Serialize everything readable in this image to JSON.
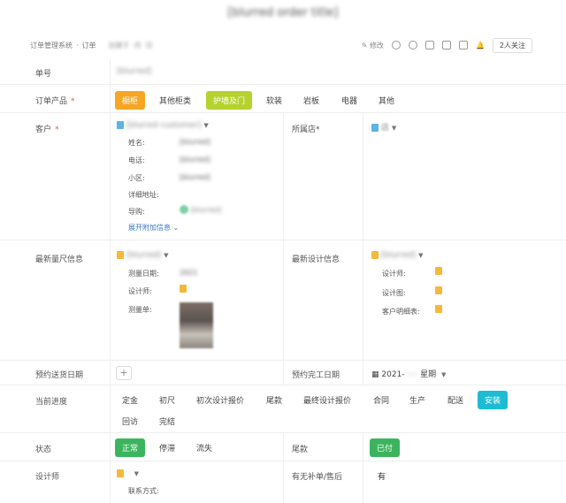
{
  "header": {
    "title": "[blurred order title]"
  },
  "breadcrumb": {
    "system": "订单管理系统",
    "sep": "·",
    "current": "订单",
    "meta": "创建于 ·月 ·日"
  },
  "toolbar": {
    "edit_label": "修改",
    "follow_label": "2人关注"
  },
  "order_no": {
    "label": "单号",
    "value": "[blurred]"
  },
  "product": {
    "label": "订单产品",
    "required": "*",
    "options": [
      {
        "label": "橱柜",
        "state": "selected-orange"
      },
      {
        "label": "其他柜类",
        "state": "normal"
      },
      {
        "label": "护墙及门",
        "state": "selected-lime"
      },
      {
        "label": "软装",
        "state": "normal"
      },
      {
        "label": "岩板",
        "state": "normal"
      },
      {
        "label": "电器",
        "state": "normal"
      },
      {
        "label": "其他",
        "state": "normal"
      }
    ]
  },
  "customer": {
    "label": "客户",
    "required": "*",
    "record": "[blurred customer]",
    "fields": [
      {
        "label": "姓名:",
        "value": "[blurred]"
      },
      {
        "label": "电话:",
        "value": "[blurred]"
      },
      {
        "label": "小区:",
        "value": "[blurred]"
      },
      {
        "label": "详细地址:",
        "value": ""
      },
      {
        "label": "导购:",
        "value": "[blurred]"
      }
    ],
    "expand_label": "展开附加信息"
  },
  "store": {
    "label": "所属店",
    "required": "*",
    "value": "店"
  },
  "measure": {
    "label": "最新量尺信息",
    "record": "[blurred]",
    "date_label": "测量日期:",
    "designer_label": "设计师:",
    "sheet_label": "测量单:"
  },
  "design": {
    "label": "最新设计信息",
    "record": "[blurred]",
    "designer_label": "设计师:",
    "drawing_label": "设计图:",
    "detail_label": "客户明细表:"
  },
  "delivery": {
    "label": "预约送货日期",
    "add_label": "+"
  },
  "completion": {
    "label": "预约完工日期",
    "value": "2021-",
    "weekday": "星期"
  },
  "progress": {
    "label": "当前进度",
    "steps": [
      {
        "label": "定金",
        "state": "normal"
      },
      {
        "label": "初尺",
        "state": "normal"
      },
      {
        "label": "初次设计报价",
        "state": "normal"
      },
      {
        "label": "尾款",
        "state": "normal"
      },
      {
        "label": "最终设计报价",
        "state": "normal"
      },
      {
        "label": "合同",
        "state": "normal"
      },
      {
        "label": "生产",
        "state": "normal"
      },
      {
        "label": "配送",
        "state": "normal"
      },
      {
        "label": "安装",
        "state": "active"
      },
      {
        "label": "回访",
        "state": "normal"
      },
      {
        "label": "完结",
        "state": "normal"
      }
    ]
  },
  "status": {
    "label": "状态",
    "options": [
      {
        "label": "正常",
        "state": "active"
      },
      {
        "label": "停滞",
        "state": "normal"
      },
      {
        "label": "流失",
        "state": "normal"
      }
    ]
  },
  "balance": {
    "label": "尾款",
    "value": "已付"
  },
  "designer": {
    "label": "设计师",
    "contact_label": "联系方式:"
  },
  "supplement": {
    "label": "有无补单/售后",
    "value": "有"
  },
  "colors": {
    "orange": "#f5a623",
    "lime": "#b5d22e",
    "green": "#3cb45e",
    "teal": "#1fbbd3",
    "link": "#3a78c4",
    "required": "#e05a4a"
  },
  "icons": [
    "edit-icon",
    "share-icon",
    "copy-icon",
    "lock-icon",
    "bell-icon",
    "calendar-icon",
    "doc-icon"
  ]
}
